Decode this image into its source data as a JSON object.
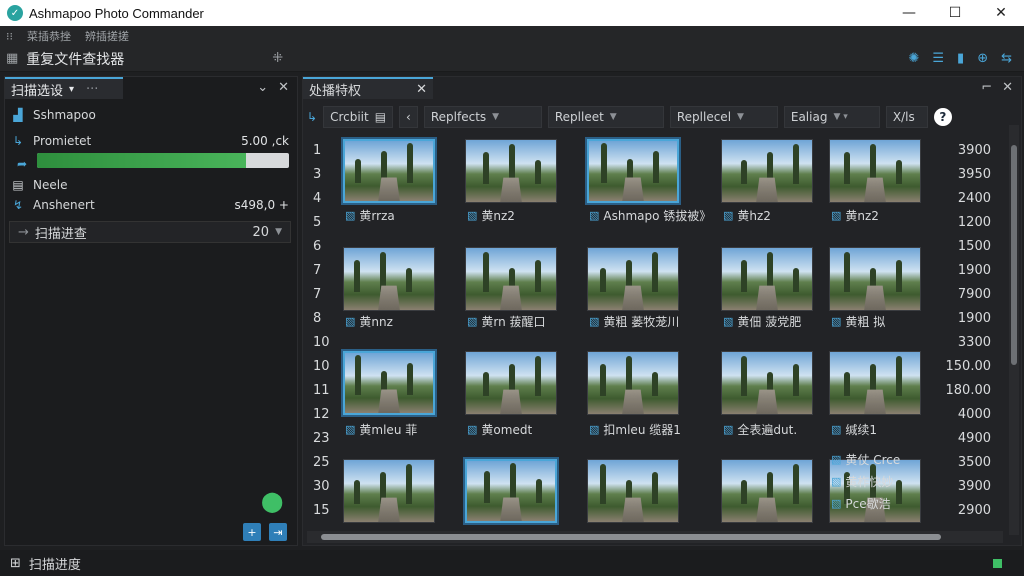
{
  "window": {
    "title": "Ashmapoo Photo Commander",
    "minimize": "—",
    "maximize": "☐",
    "close": "✕"
  },
  "menu": {
    "items": [
      "菜插恭挫",
      "辨插搓搓"
    ]
  },
  "toolbar": {
    "title": "重复文件查找器",
    "pin": "⁜"
  },
  "left_panel": {
    "tab_label": "扫描选设",
    "tab_extra": "···",
    "rows": [
      {
        "icon": "folder-icon",
        "label": "Sshmapoo",
        "value": ""
      },
      {
        "icon": "link-icon",
        "label": "Promietet",
        "value": "5.00 ,ck"
      },
      {
        "icon": "share-icon",
        "label": "",
        "value": ""
      },
      {
        "icon": "file-icon",
        "label": "Neele",
        "value": ""
      },
      {
        "icon": "sync-icon",
        "label": "Anshenert",
        "value": "s498,0 +"
      }
    ],
    "progress": 0.83,
    "dropdown": {
      "label": "扫描进查",
      "value": "20"
    }
  },
  "status": {
    "label": "扫描进度"
  },
  "right_panel": {
    "tab_label": "处播特权",
    "filter": {
      "first": "Crcbiit",
      "items": [
        "Replfects",
        "Replleet",
        "Repllecel",
        "Ealiag"
      ],
      "last": "X/ls"
    },
    "row_numbers": [
      "1",
      "3",
      "4",
      "5",
      "6",
      "7",
      "7",
      "8",
      "10",
      "10",
      "11",
      "12",
      "23",
      "25",
      "30",
      "15"
    ],
    "right_numbers": [
      "3900",
      "3950",
      "2400",
      "1200",
      "1500",
      "1900",
      "7900",
      "1900",
      "3300",
      "150.00",
      "180.00",
      "4000",
      "4900",
      "3500",
      "3900",
      "2900"
    ],
    "captions": [
      [
        "黄rrza",
        "黄nz2",
        "Ashmapo 锈拔被》",
        "黄hz2",
        "黄nz2"
      ],
      [
        "黄nnz",
        "黄rn 菝醒口",
        "黄粗 蒌牧茏川",
        "黄佃 菠党肥",
        "黄粗 拟"
      ],
      [
        "黄mleu 菲",
        "黄omedt",
        "扣mleu 缆器1",
        "全表遍dut.",
        "缄续1"
      ],
      [
        "",
        "",
        "",
        "",
        "黄仗 Crce"
      ],
      [
        "",
        "",
        "",
        "",
        "黄柞快妙"
      ],
      [
        "",
        "",
        "",
        "",
        "Pce歇浩"
      ]
    ]
  }
}
